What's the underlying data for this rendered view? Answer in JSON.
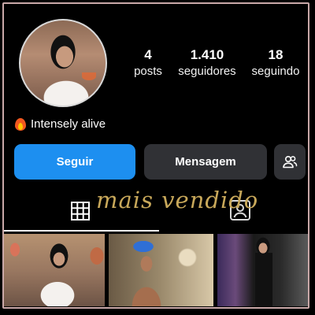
{
  "profile": {
    "stats": [
      {
        "value": "4",
        "label": "posts"
      },
      {
        "value": "1.410",
        "label": "seguidores"
      },
      {
        "value": "18",
        "label": "seguindo"
      }
    ],
    "bio": "Intensely alive",
    "bio_icon": "fire-icon"
  },
  "actions": {
    "follow_label": "Seguir",
    "message_label": "Mensagem",
    "suggest_icon": "add-people-icon"
  },
  "tabs": {
    "grid_icon": "grid-icon",
    "tagged_icon": "tagged-person-icon",
    "brand_text": "mais vendido"
  },
  "colors": {
    "follow_button": "#1d8ff0",
    "secondary_button": "#303135",
    "brand_gold": "#c8a85a",
    "frame_border": "#c9a8a8"
  }
}
